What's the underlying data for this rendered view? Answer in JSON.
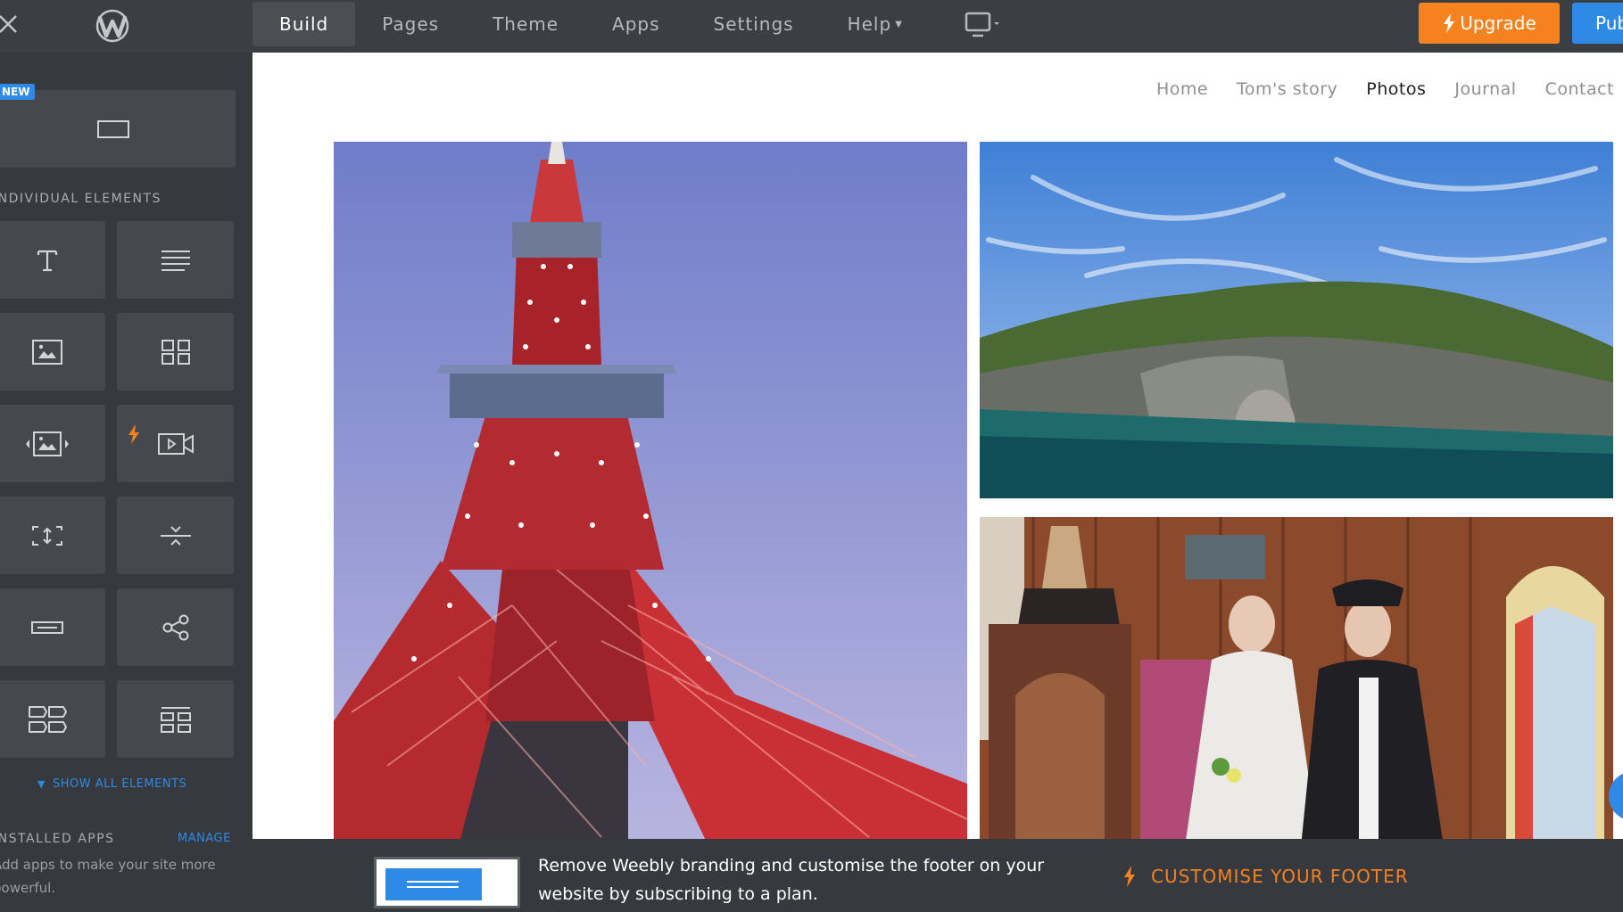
{
  "topbar": {
    "tabs": [
      {
        "label": "Build"
      },
      {
        "label": "Pages"
      },
      {
        "label": "Theme"
      },
      {
        "label": "Apps"
      },
      {
        "label": "Settings"
      },
      {
        "label": "Help"
      }
    ],
    "active_tab": "Build",
    "upgrade_label": "Upgrade",
    "publish_label": "Publish"
  },
  "sidebar": {
    "new_badge": "NEW",
    "section_label": "INDIVIDUAL ELEMENTS",
    "elements": [
      {
        "icon": "title-icon"
      },
      {
        "icon": "text-icon"
      },
      {
        "icon": "image-icon"
      },
      {
        "icon": "gallery-icon"
      },
      {
        "icon": "slideshow-icon"
      },
      {
        "icon": "video-icon"
      },
      {
        "icon": "spacer-icon"
      },
      {
        "icon": "divider-icon"
      },
      {
        "icon": "button-icon"
      },
      {
        "icon": "social-icon"
      },
      {
        "icon": "layout-icon"
      },
      {
        "icon": "columns-icon"
      }
    ],
    "show_all_label": "SHOW ALL ELEMENTS",
    "apps_label": "INSTALLED APPS",
    "manage_label": "MANAGE",
    "apps_description": "Add apps to make your site more powerful."
  },
  "site": {
    "nav": [
      {
        "label": "Home"
      },
      {
        "label": "Tom's story"
      },
      {
        "label": "Photos"
      },
      {
        "label": "Journal"
      },
      {
        "label": "Contact"
      }
    ],
    "current_page": "Photos"
  },
  "footer": {
    "message": "Remove Weebly branding and customise the footer on your website by subscribing to a plan.",
    "cta_label": "CUSTOMISE YOUR FOOTER"
  },
  "colors": {
    "topbar": "#3b3e42",
    "sidebar": "#36393d",
    "tile": "#45484d",
    "accent_blue": "#2f8ae5",
    "accent_orange": "#f5821f"
  }
}
